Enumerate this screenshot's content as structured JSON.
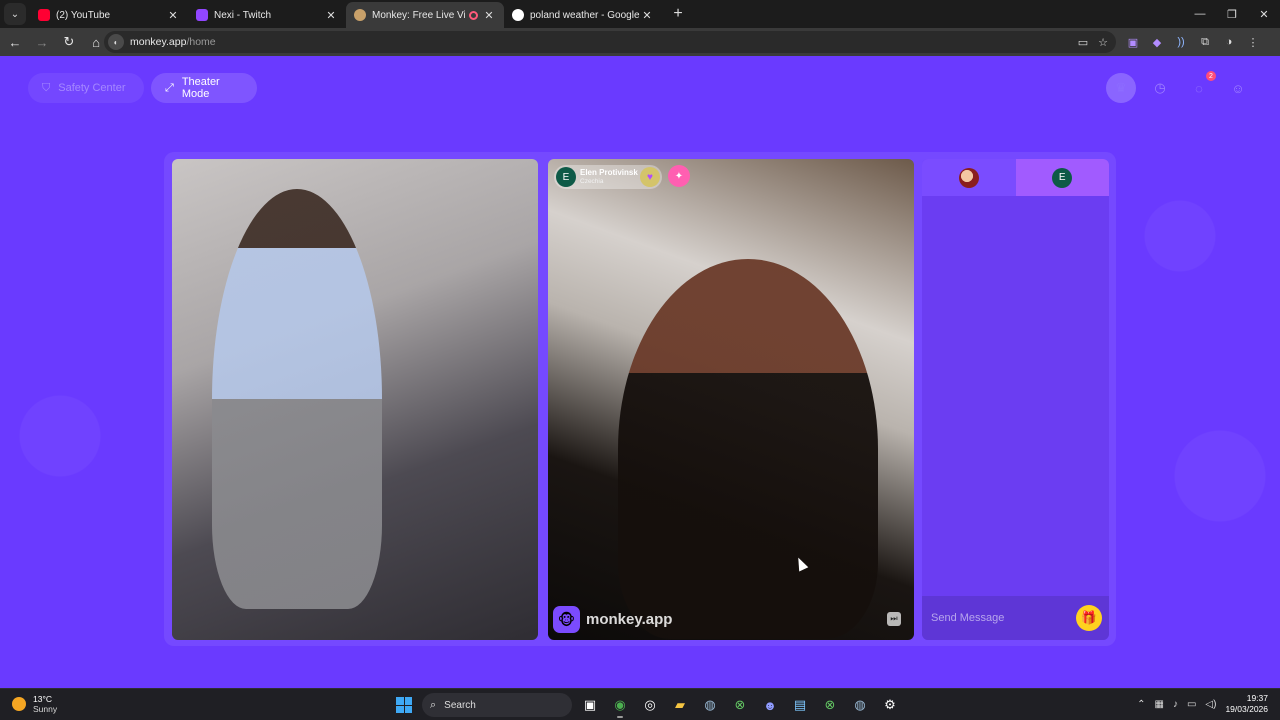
{
  "browser": {
    "tabs": [
      {
        "title": "(2) YouTube",
        "color": "#ff0033",
        "active": false
      },
      {
        "title": "Nexi - Twitch",
        "color": "#9146ff",
        "active": false
      },
      {
        "title": "Monkey: Free Live Video Ch",
        "color": "#c9a16a",
        "active": true
      },
      {
        "title": "poland weather - Google Searc",
        "color": "#ffffff",
        "active": false
      }
    ],
    "address": {
      "domain": "monkey.app",
      "path": "/home"
    }
  },
  "app": {
    "safety_center": "Safety Center",
    "theater_mode": "Theater Mode",
    "notification_count": "2",
    "remote_user": {
      "initial": "E",
      "name": "Elen Protivinsk",
      "country": "Czechia"
    },
    "watermark": "monkey.app",
    "chat": {
      "tab2_initial": "E",
      "placeholder": "Send Message"
    }
  },
  "taskbar": {
    "weather": {
      "temp": "13°C",
      "condition": "Sunny"
    },
    "search_label": "Search",
    "time": "19:37",
    "date": "19/03/2026"
  }
}
